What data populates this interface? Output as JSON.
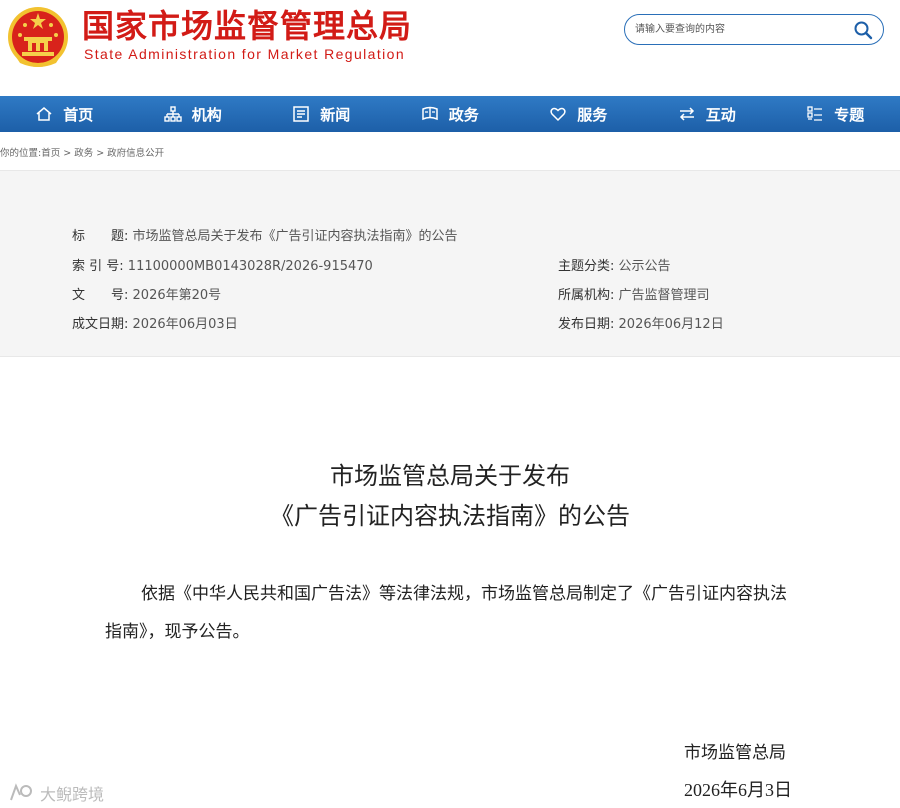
{
  "header": {
    "title_cn": "国家市场监督管理总局",
    "title_en": "State Administration for Market Regulation",
    "search_placeholder": "请输入要查询的内容",
    "search_icon": "search-icon"
  },
  "nav": {
    "items": [
      {
        "label": "首页",
        "icon": "home-icon"
      },
      {
        "label": "机构",
        "icon": "org-icon"
      },
      {
        "label": "新闻",
        "icon": "news-icon"
      },
      {
        "label": "政务",
        "icon": "affairs-icon"
      },
      {
        "label": "服务",
        "icon": "heart-icon"
      },
      {
        "label": "互动",
        "icon": "exchange-icon"
      },
      {
        "label": "专题",
        "icon": "topics-icon"
      }
    ]
  },
  "breadcrumb": {
    "prefix": "你的位置:",
    "items": [
      "首页",
      "政务",
      "政府信息公开"
    ],
    "separator": ">"
  },
  "info": {
    "title_label": "标　　题:",
    "title_value": "市场监管总局关于发布《广告引证内容执法指南》的公告",
    "index_label": "索 引 号:",
    "index_value": "11100000MB0143028R/2026-915470",
    "doc_label": "文　　号:",
    "doc_value": "2026年第20号",
    "date_label": "成文日期:",
    "date_value": "2026年06月03日",
    "topic_label": "主题分类:",
    "topic_value": "公示公告",
    "org_label": "所属机构:",
    "org_value": "广告监督管理司",
    "pub_label": "发布日期:",
    "pub_value": "2026年06月12日"
  },
  "article": {
    "title_line1": "市场监管总局关于发布",
    "title_line2": "《广告引证内容执法指南》的公告",
    "body": "依据《中华人民共和国广告法》等法律法规，市场监管总局制定了《广告引证内容执法指南》，现予公告。",
    "signature": "市场监管总局",
    "sign_date": "2026年6月3日"
  },
  "watermark": {
    "text": "大鲵跨境"
  },
  "colors": {
    "brand_red": "#d21b16",
    "nav_blue": "#1d5fa8"
  }
}
